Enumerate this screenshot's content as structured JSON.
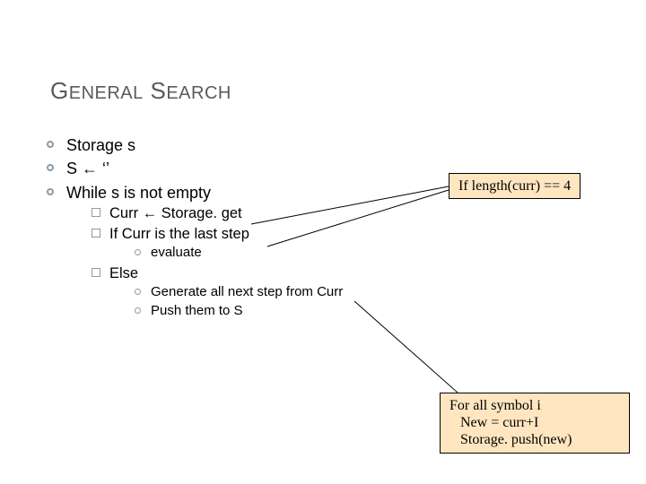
{
  "title_html": "G<span style='font-size:20px'>ENERAL</span> S<span style='font-size:20px'>EARCH</span>",
  "title_plain": "GENERAL SEARCH",
  "bullets": {
    "b1": "Storage s",
    "b2": "S ← ‘’",
    "b3": "While s is not empty",
    "b3_1": "Curr ← Storage. get",
    "b3_2": "If Curr is the last step",
    "b3_2_1": "evaluate",
    "b3_3": "Else",
    "b3_3_1": "Generate all next step from Curr",
    "b3_3_2": "Push them to S"
  },
  "callout1": "If length(curr) == 4",
  "callout2": "For all symbol i\n   New = curr+I\n   Storage. push(new)"
}
